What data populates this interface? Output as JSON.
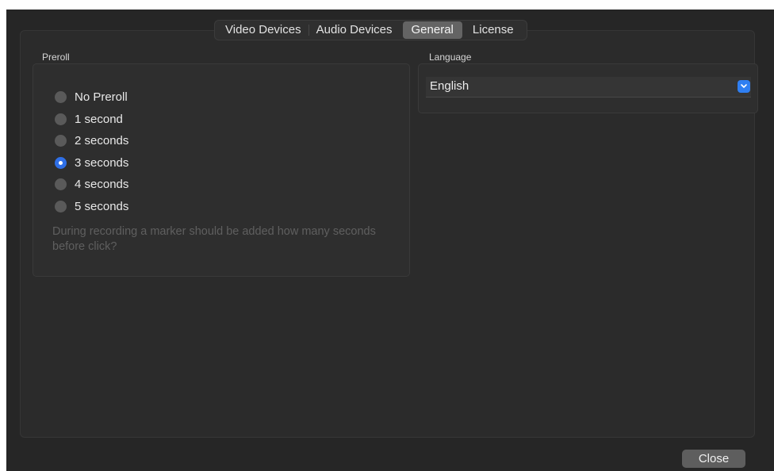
{
  "tabs": [
    {
      "label": "Video Devices",
      "selected": false
    },
    {
      "label": "Audio Devices",
      "selected": false
    },
    {
      "label": "General",
      "selected": true
    },
    {
      "label": "License",
      "selected": false
    }
  ],
  "preroll": {
    "title": "Preroll",
    "options": [
      {
        "label": "No Preroll",
        "checked": false
      },
      {
        "label": "1 second",
        "checked": false
      },
      {
        "label": "2 seconds",
        "checked": false
      },
      {
        "label": "3 seconds",
        "checked": true
      },
      {
        "label": "4 seconds",
        "checked": false
      },
      {
        "label": "5 seconds",
        "checked": false
      }
    ],
    "hint": "During recording a marker should be added how many seconds before click?"
  },
  "language": {
    "title": "Language",
    "selected": "English"
  },
  "footer": {
    "close_label": "Close"
  },
  "colors": {
    "accent": "#2f6fe6",
    "window_bg": "#262626"
  },
  "icons": {
    "select_arrow": "chevron-down-icon"
  }
}
